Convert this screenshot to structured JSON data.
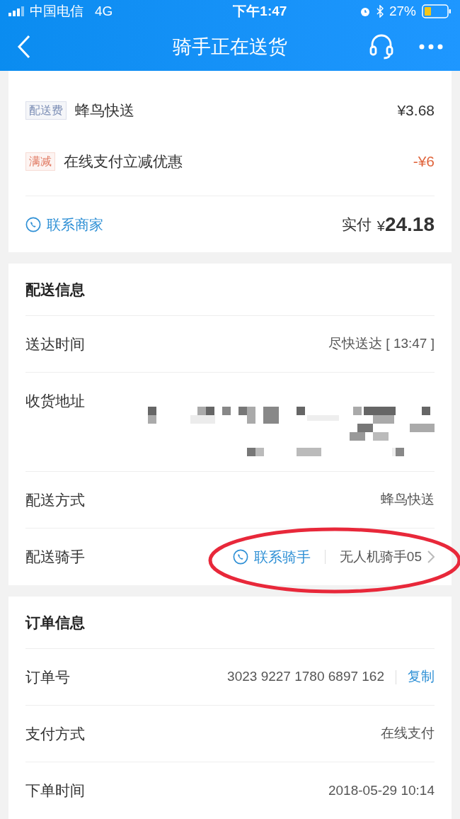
{
  "status_bar": {
    "carrier": "中国电信",
    "network": "4G",
    "time": "下午1:47",
    "battery": "27%"
  },
  "nav": {
    "title": "骑手正在送货"
  },
  "fees": [
    {
      "tag": "配送费",
      "color": "#7b8db5",
      "label": "蜂鸟快送",
      "amount": "¥3.68",
      "kind": "charge"
    },
    {
      "tag": "满减",
      "color": "#e0775f",
      "label": "在线支付立减优惠",
      "amount": "-¥6",
      "kind": "discount"
    }
  ],
  "total": {
    "contact": "联系商家",
    "label": "实付",
    "currency": "¥",
    "amount": "24.18"
  },
  "delivery": {
    "title": "配送信息",
    "rows": [
      {
        "kind": "text",
        "label": "送达时间",
        "value": "尽快送达 [ 13:47 ]"
      },
      {
        "kind": "address",
        "label": "收货地址"
      },
      {
        "kind": "text",
        "label": "配送方式",
        "value": "蜂鸟快送"
      },
      {
        "kind": "rider",
        "label": "配送骑手",
        "contact": "联系骑手",
        "value": "无人机骑手05"
      }
    ]
  },
  "order": {
    "title": "订单信息",
    "rows": [
      {
        "kind": "copy",
        "label": "订单号",
        "value": "3023 9227 1780 6897 162",
        "action": "复制"
      },
      {
        "kind": "text",
        "label": "支付方式",
        "value": "在线支付"
      },
      {
        "kind": "text",
        "label": "下单时间",
        "value": "2018-05-29 10:14"
      }
    ]
  }
}
